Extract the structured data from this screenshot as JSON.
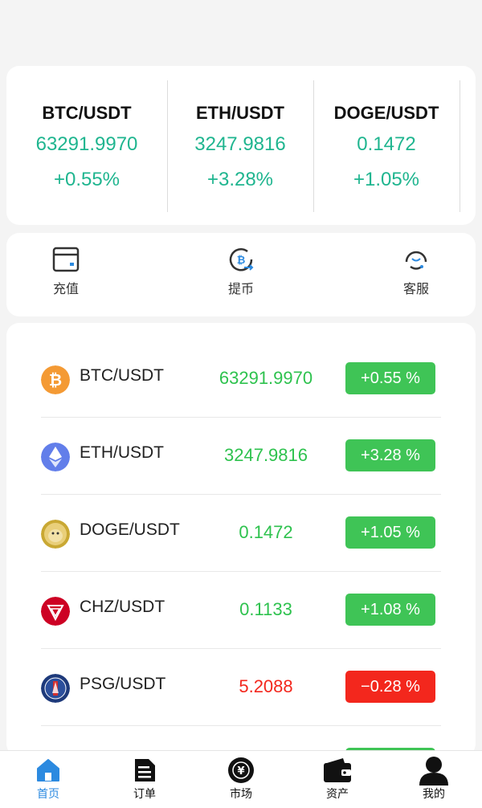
{
  "tickers": [
    {
      "pair": "BTC/USDT",
      "price": "63291.9970",
      "change": "+0.55%"
    },
    {
      "pair": "ETH/USDT",
      "price": "3247.9816",
      "change": "+3.28%"
    },
    {
      "pair": "DOGE/USDT",
      "price": "0.1472",
      "change": "+1.05%"
    }
  ],
  "actions": {
    "deposit": "充值",
    "withdraw": "提币",
    "service": "客服"
  },
  "markets": [
    {
      "pair": "BTC/USDT",
      "price": "63291.9970",
      "change": "+0.55 %",
      "trend": "up",
      "icon": "bitcoin-icon"
    },
    {
      "pair": "ETH/USDT",
      "price": "3247.9816",
      "change": "+3.28 %",
      "trend": "up",
      "icon": "ethereum-icon"
    },
    {
      "pair": "DOGE/USDT",
      "price": "0.1472",
      "change": "+1.05 %",
      "trend": "up",
      "icon": "dogecoin-icon"
    },
    {
      "pair": "CHZ/USDT",
      "price": "0.1133",
      "change": "+1.08 %",
      "trend": "up",
      "icon": "chiliz-icon"
    },
    {
      "pair": "PSG/USDT",
      "price": "5.2088",
      "change": "−0.28 %",
      "trend": "down",
      "icon": "psg-icon"
    }
  ],
  "tabs": {
    "home": "首页",
    "orders": "订单",
    "market": "市场",
    "assets": "资产",
    "mine": "我的"
  },
  "colors": {
    "accent": "#2c8ae0",
    "up": "#2ec24e",
    "down": "#f3271d",
    "ticker_green": "#1fb58f"
  }
}
